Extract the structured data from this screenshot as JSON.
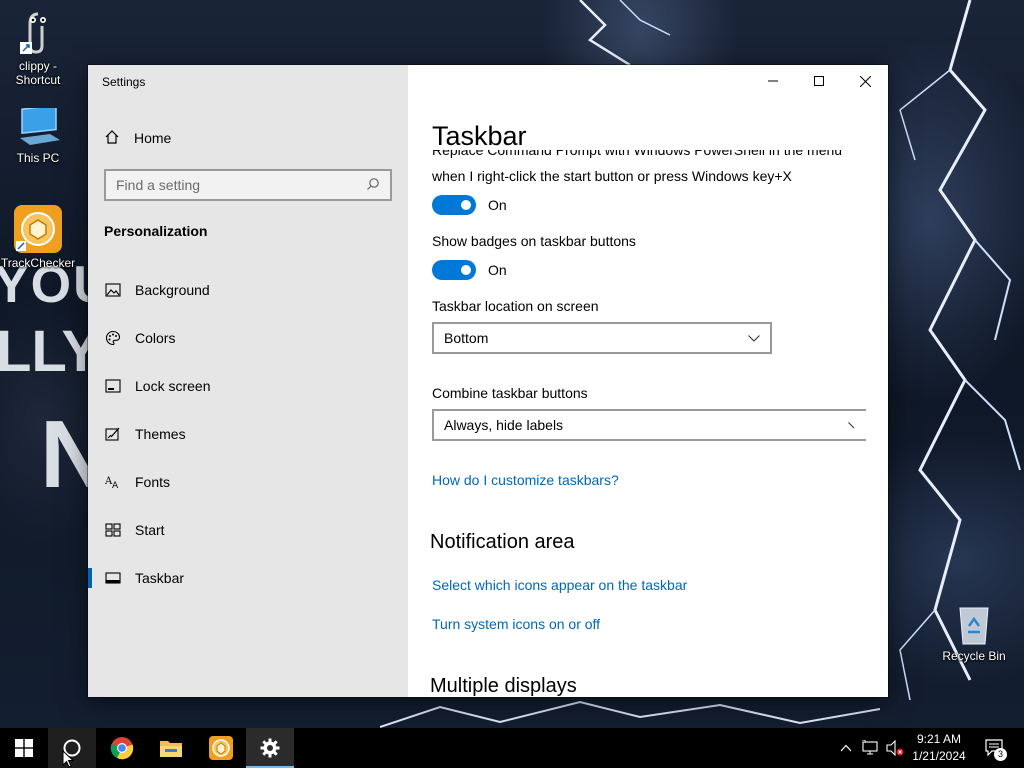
{
  "desktop": {
    "icons": [
      {
        "label": "clippy - Shortcut"
      },
      {
        "label": "This PC"
      },
      {
        "label": "TrackChecker"
      },
      {
        "label": "Recycle Bin"
      }
    ]
  },
  "window": {
    "title": "Settings"
  },
  "sidebar": {
    "home_label": "Home",
    "search_placeholder": "Find a setting",
    "section_heading": "Personalization",
    "items": [
      {
        "label": "Background",
        "icon": "picture-icon"
      },
      {
        "label": "Colors",
        "icon": "palette-icon"
      },
      {
        "label": "Lock screen",
        "icon": "lock-screen-icon"
      },
      {
        "label": "Themes",
        "icon": "themes-icon"
      },
      {
        "label": "Fonts",
        "icon": "fonts-icon"
      },
      {
        "label": "Start",
        "icon": "start-icon"
      },
      {
        "label": "Taskbar",
        "icon": "taskbar-icon",
        "selected": true
      }
    ]
  },
  "content": {
    "title": "Taskbar",
    "clipped_line": "Replace Command Prompt with Windows PowerShell in the menu",
    "powershell_line2": "when I right-click the start button or press Windows key+X",
    "powershell_toggle": "On",
    "badges_label": "Show badges on taskbar buttons",
    "badges_toggle": "On",
    "location_label": "Taskbar location on screen",
    "location_value": "Bottom",
    "combine_label": "Combine taskbar buttons",
    "combine_value": "Always, hide labels",
    "customize_link": "How do I customize taskbars?",
    "notification_heading": "Notification area",
    "select_icons_link": "Select which icons appear on the taskbar",
    "system_icons_link": "Turn system icons on or off",
    "multiple_displays_heading": "Multiple displays"
  },
  "taskbar": {
    "time": "9:21 AM",
    "date": "1/21/2024",
    "notification_count": "3"
  },
  "colors": {
    "accent": "#0078d7",
    "link": "#0067b8",
    "sidebar_bg": "#e6e6e6"
  }
}
